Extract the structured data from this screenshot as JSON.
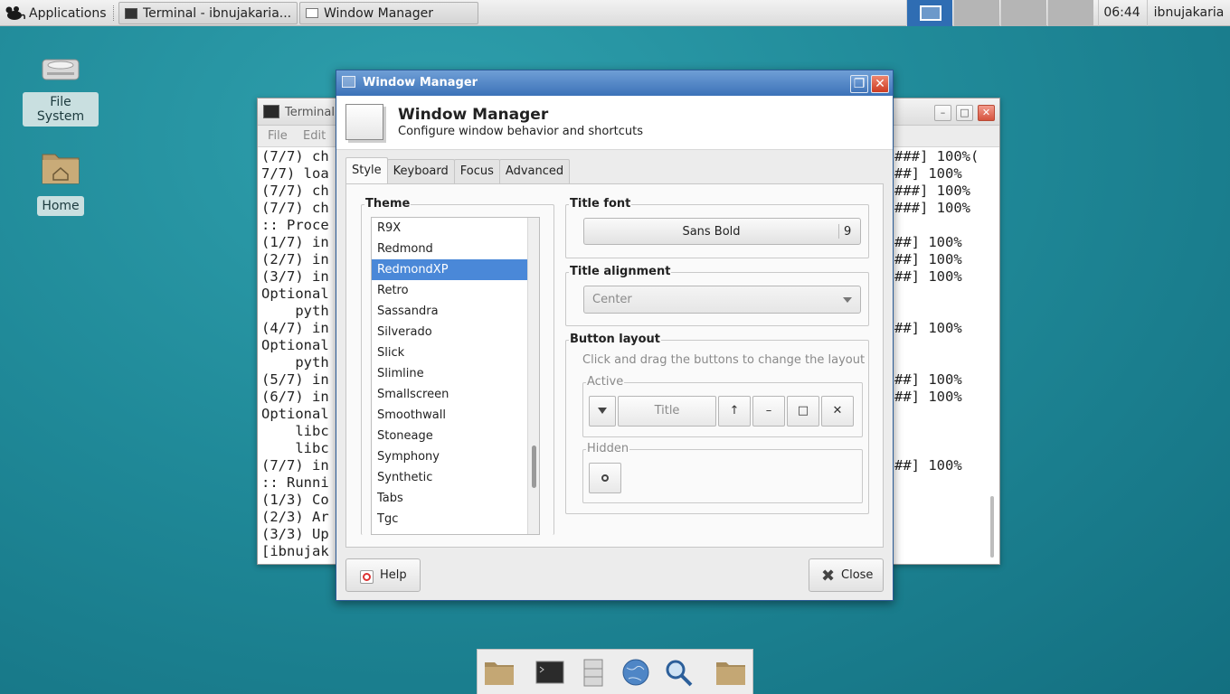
{
  "panel": {
    "applications": "Applications",
    "tasks": [
      {
        "label": "Terminal - ibnujakaria..."
      },
      {
        "label": "Window Manager"
      }
    ],
    "clock": "06:44",
    "user": "ibnujakaria"
  },
  "desktop": {
    "icons": [
      {
        "label": "File System"
      },
      {
        "label": "Home"
      }
    ]
  },
  "terminal": {
    "title": "Terminal",
    "menu": [
      "File",
      "Edit"
    ],
    "lines": [
      "(7/7) ch",
      "7/7) loa",
      "(7/7) ch",
      "(7/7) ch",
      ":: Proce",
      "(1/7) in",
      "(2/7) in",
      "(3/7) in",
      "Optional",
      "    pyth",
      "(4/7) in",
      "Optional",
      "    pyth",
      "(5/7) in",
      "(6/7) in",
      "Optional",
      "    libc",
      "    libc",
      "(7/7) in",
      ":: Runni",
      "(1/3) Co",
      "(2/3) Ar",
      "(3/3) Up",
      "[ibnujak"
    ],
    "right_lines": [
      "###] 100%(",
      "##] 100%",
      "###] 100%",
      "###] 100%",
      "",
      "##] 100%",
      "##] 100%",
      "##] 100%",
      "",
      "",
      "##] 100%",
      "",
      "",
      "##] 100%",
      "##] 100%",
      "",
      "",
      "",
      "##] 100%",
      "",
      "",
      "",
      "",
      ""
    ]
  },
  "wm": {
    "window_title": "Window Manager",
    "heading": "Window Manager",
    "subheading": "Configure window behavior and shortcuts",
    "tabs": [
      "Style",
      "Keyboard",
      "Focus",
      "Advanced"
    ],
    "theme_label": "Theme",
    "themes": [
      "R9X",
      "Redmond",
      "RedmondXP",
      "Retro",
      "Sassandra",
      "Silverado",
      "Slick",
      "Slimline",
      "Smallscreen",
      "Smoothwall",
      "Stoneage",
      "Symphony",
      "Synthetic",
      "Tabs",
      "Tgc"
    ],
    "selected_theme": "RedmondXP",
    "title_font_label": "Title font",
    "font_name": "Sans Bold",
    "font_size": "9",
    "title_alignment_label": "Title alignment",
    "alignment": "Center",
    "button_layout_label": "Button layout",
    "button_layout_hint": "Click and drag the buttons to change the layout",
    "active_label": "Active",
    "title_button": "Title",
    "hidden_label": "Hidden",
    "help": "Help",
    "close": "Close"
  },
  "colors": {
    "selection": "#4a88d8",
    "titlebar": "#3c72b8",
    "desktop": "#208a99"
  }
}
